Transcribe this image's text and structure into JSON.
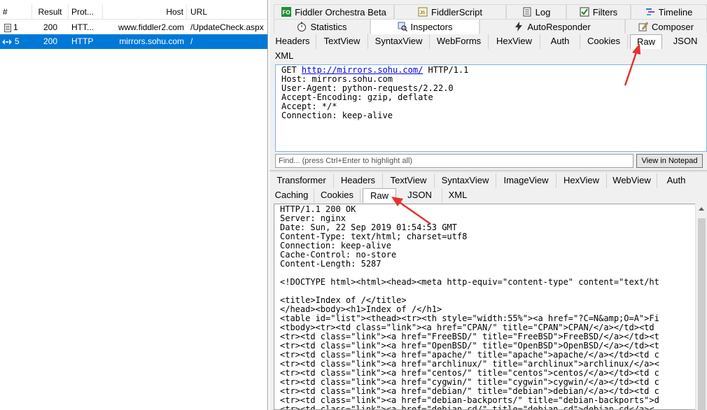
{
  "sessions": {
    "columns": [
      "#",
      "Result",
      "Prot...",
      "Host",
      "URL"
    ],
    "rows": [
      {
        "num": "1",
        "result": "200",
        "protocol": "HTT...",
        "host": "www.fiddler2.com",
        "url": "/UpdateCheck.aspx",
        "selected": false
      },
      {
        "num": "5",
        "result": "200",
        "protocol": "HTTP",
        "host": "mirrors.sohu.com",
        "url": "/",
        "selected": true
      }
    ]
  },
  "main_tabs_row1": [
    {
      "label": "Fiddler Orchestra Beta",
      "icon": "fo-logo-icon"
    },
    {
      "label": "FiddlerScript",
      "icon": "script-icon"
    },
    {
      "label": "Log",
      "icon": "log-icon"
    },
    {
      "label": "Filters",
      "icon": "checkbox-icon"
    },
    {
      "label": "Timeline",
      "icon": "timeline-icon"
    }
  ],
  "main_tabs_row2": [
    {
      "label": "Statistics",
      "icon": "stopwatch-icon"
    },
    {
      "label": "Inspectors",
      "icon": "inspect-icon",
      "active": true
    },
    {
      "label": "AutoResponder",
      "icon": "lightning-icon"
    },
    {
      "label": "Composer",
      "icon": "pencil-icon"
    }
  ],
  "request": {
    "tabs": [
      "Headers",
      "TextView",
      "SyntaxView",
      "WebForms",
      "HexView",
      "Auth",
      "Cookies",
      "Raw",
      "JSON",
      "XML"
    ],
    "selected_tab": "Raw",
    "method": "GET",
    "url": "http://mirrors.sohu.com/",
    "version": "HTTP/1.1",
    "headers": [
      "Host: mirrors.sohu.com",
      "User-Agent: python-requests/2.22.0",
      "Accept-Encoding: gzip, deflate",
      "Accept: */*",
      "Connection: keep-alive"
    ],
    "find_placeholder": "Find... (press Ctrl+Enter to highlight all)",
    "notepad_button": "View in Notepad"
  },
  "response": {
    "tabs_row1": [
      "Transformer",
      "Headers",
      "TextView",
      "SyntaxView",
      "ImageView",
      "HexView",
      "WebView",
      "Auth"
    ],
    "tabs_row2": [
      "Caching",
      "Cookies",
      "Raw",
      "JSON",
      "XML"
    ],
    "selected_tab": "Raw",
    "lines": [
      "HTTP/1.1 200 OK",
      "Server: nginx",
      "Date: Sun, 22 Sep 2019 01:54:53 GMT",
      "Content-Type: text/html; charset=utf8",
      "Connection: keep-alive",
      "Cache-Control: no-store",
      "Content-Length: 5287",
      "",
      "<!DOCTYPE html><html><head><meta http-equiv=\"content-type\" content=\"text/ht",
      "",
      "<title>Index of /</title>",
      "</head><body><h1>Index of /</h1>",
      "<table id=\"list\"><thead><tr><th style=\"width:55%\"><a href=\"?C=N&amp;O=A\">Fi",
      "<tbody><tr><td class=\"link\"><a href=\"CPAN/\" title=\"CPAN\">CPAN/</a></td><td",
      "<tr><td class=\"link\"><a href=\"FreeBSD/\" title=\"FreeBSD\">FreeBSD/</a></td><t",
      "<tr><td class=\"link\"><a href=\"OpenBSD/\" title=\"OpenBSD\">OpenBSD/</a></td><t",
      "<tr><td class=\"link\"><a href=\"apache/\" title=\"apache\">apache/</a></td><td c",
      "<tr><td class=\"link\"><a href=\"archlinux/\" title=\"archlinux\">archlinux/</a><",
      "<tr><td class=\"link\"><a href=\"centos/\" title=\"centos\">centos/</a></td><td c",
      "<tr><td class=\"link\"><a href=\"cygwin/\" title=\"cygwin\">cygwin/</a></td><td c",
      "<tr><td class=\"link\"><a href=\"debian/\" title=\"debian\">debian/</a></td><td c",
      "<tr><td class=\"link\"><a href=\"debian-backports/\" title=\"debian-backports\">d",
      "<tr><td class=\"link\"><a href=\"debian-cd/\" title=\"debian-cd\">debian-cd</a><"
    ]
  },
  "colors": {
    "selection": "#0078d7",
    "annotation_arrow": "#e8312f",
    "link": "#0000ee"
  }
}
